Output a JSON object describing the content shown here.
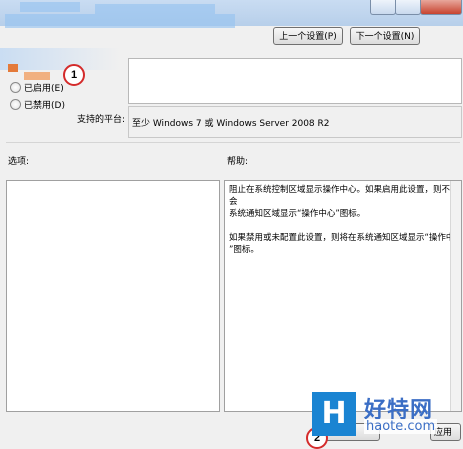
{
  "nav": {
    "prev_label": "上一个设置(P)",
    "next_label": "下一个设置(N)"
  },
  "options": {
    "enabled_label": "已启用(E)",
    "disabled_label": "已禁用(D)"
  },
  "platform": {
    "label": "支持的平台:",
    "value": "至少 Windows 7 或 Windows Server 2008 R2"
  },
  "sections": {
    "options_label": "选项:",
    "help_label": "帮助:"
  },
  "help": {
    "text": "阻止在系统控制区域显示操作中心。如果启用此设置，则不会\n系统通知区域显示“操作中心”图标。\n\n如果禁用或未配置此设置，则将在系统通知区域显示“操作中\n”图标。"
  },
  "bottom": {
    "apply_label": "应用"
  },
  "callouts": {
    "first": "1",
    "second": "2"
  },
  "watermark": {
    "logo": "H",
    "title": "好特网",
    "url": "haote.com"
  },
  "colors": {
    "callout_border": "#d42b2b",
    "watermark_blue": "#1a84d2"
  }
}
